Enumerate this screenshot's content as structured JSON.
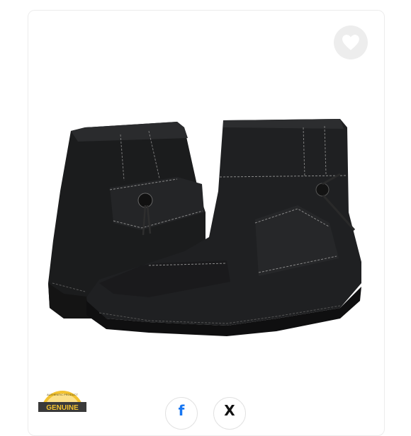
{
  "product": {
    "image_alt": "Black leather ankle boots",
    "favorite_icon": "heart-icon"
  },
  "badge": {
    "top_text": "AUTHENTIC PRODUCT",
    "main_text": "GENUINE"
  },
  "share": [
    {
      "network": "facebook",
      "glyph": "f",
      "icon": "facebook-icon"
    },
    {
      "network": "x",
      "glyph": "X",
      "icon": "x-icon"
    }
  ],
  "colors": {
    "favorite_bg": "#ededed",
    "badge_gold": "#f2c230",
    "facebook_blue": "#1877f2"
  }
}
